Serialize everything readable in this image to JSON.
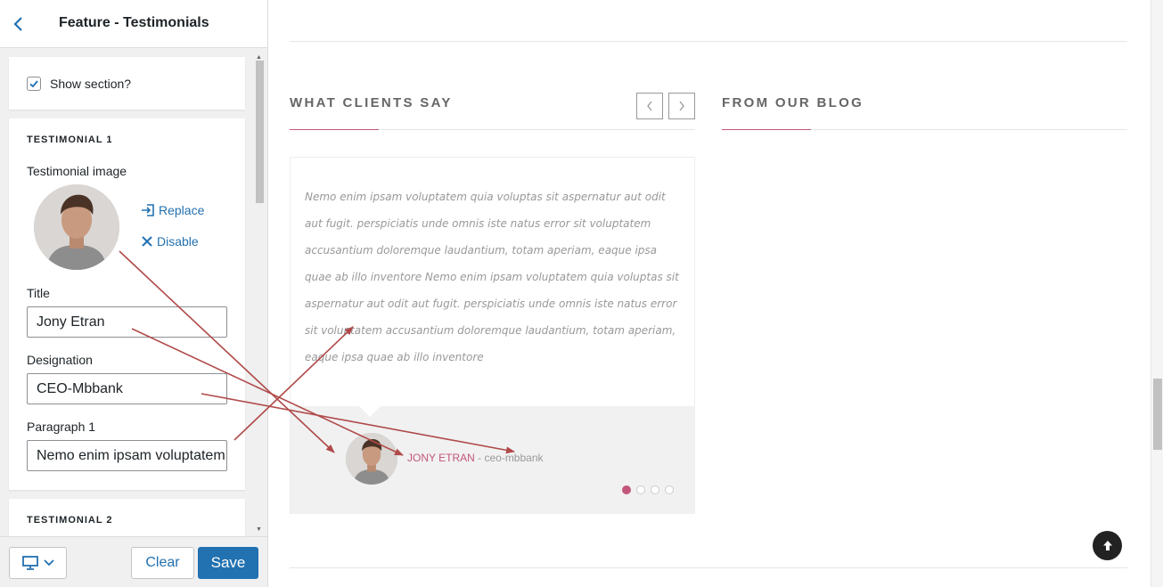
{
  "panel": {
    "title": "Feature - Testimonials",
    "show_section_label": "Show section?",
    "show_section_checked": true,
    "testimonial1": {
      "heading": "TESTIMONIAL 1",
      "image_label": "Testimonial image",
      "replace_label": "Replace",
      "disable_label": "Disable",
      "title_label": "Title",
      "title_value": "Jony Etran",
      "designation_label": "Designation",
      "designation_value": "CEO-Mbbank",
      "paragraph_label": "Paragraph 1",
      "paragraph_value": "Nemo enim ipsam voluptatem"
    },
    "testimonial2": {
      "heading": "TESTIMONIAL 2"
    },
    "footer": {
      "clear_label": "Clear",
      "save_label": "Save"
    }
  },
  "preview": {
    "clients_title": "WHAT CLIENTS SAY",
    "blog_title": "FROM OUR BLOG",
    "prev_arrow": "‹",
    "next_arrow": "›",
    "quote": "Nemo enim ipsam voluptatem quia voluptas sit aspernatur aut odit aut fugit. perspiciatis unde omnis iste natus error sit voluptatem accusantium doloremque laudantium, totam aperiam, eaque ipsa quae ab illo inventore Nemo enim ipsam voluptatem quia voluptas sit aspernatur aut odit aut fugit. perspiciatis unde omnis iste natus error sit voluptatem accusantium doloremque laudantium, totam aperiam, eaque ipsa quae ab illo inventore",
    "author_name": "Jony Etran",
    "author_separator": " - ",
    "author_role": "CEO-Mbbank",
    "slide_count": 4,
    "active_slide": 1
  },
  "colors": {
    "accent": "#c2567b",
    "primary_button": "#2271b1",
    "annotation_arrow": "#b04a4a"
  }
}
